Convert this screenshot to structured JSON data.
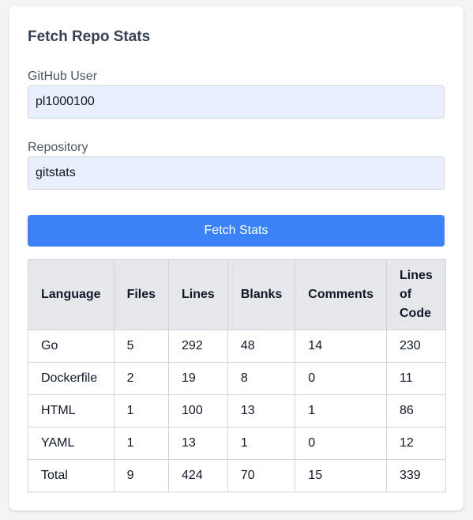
{
  "form": {
    "title": "Fetch Repo Stats",
    "user_label": "GitHub User",
    "user_value": "pl1000100",
    "repo_label": "Repository",
    "repo_value": "gitstats",
    "submit_label": "Fetch Stats"
  },
  "table": {
    "headers": {
      "language": "Language",
      "files": "Files",
      "lines": "Lines",
      "blanks": "Blanks",
      "comments": "Comments",
      "loc_line1": "Lines",
      "loc_line2": "of",
      "loc_line3": "Code"
    },
    "rows": [
      {
        "language": "Go",
        "files": "5",
        "lines": "292",
        "blanks": "48",
        "comments": "14",
        "loc": "230"
      },
      {
        "language": "Dockerfile",
        "files": "2",
        "lines": "19",
        "blanks": "8",
        "comments": "0",
        "loc": "11"
      },
      {
        "language": "HTML",
        "files": "1",
        "lines": "100",
        "blanks": "13",
        "comments": "1",
        "loc": "86"
      },
      {
        "language": "YAML",
        "files": "1",
        "lines": "13",
        "blanks": "1",
        "comments": "0",
        "loc": "12"
      },
      {
        "language": "Total",
        "files": "9",
        "lines": "424",
        "blanks": "70",
        "comments": "15",
        "loc": "339"
      }
    ]
  },
  "colors": {
    "primary_button": "#3b82f6",
    "input_background": "#e8f0fe",
    "header_background": "#e5e7eb"
  }
}
